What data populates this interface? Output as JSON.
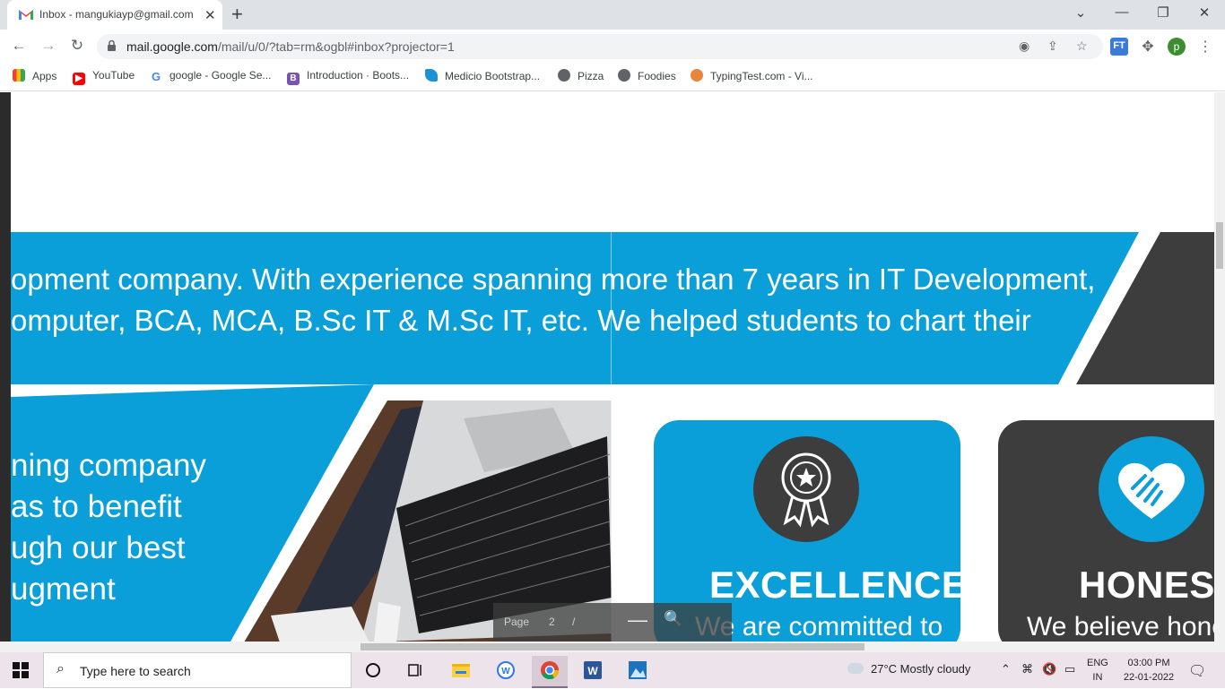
{
  "browser": {
    "tab_title": "Inbox - mangukiayp@gmail.com",
    "tab_close": "✕",
    "new_tab": "+",
    "window": {
      "minimize": "⌄",
      "min": "—",
      "restore": "❐",
      "close": "✕"
    },
    "url_host": "mail.google.com",
    "url_path": "/mail/u/0/?tab=rm&ogbl#inbox?projector=1",
    "profile_initial": "p",
    "ext_label": "FT"
  },
  "bookmarks": [
    {
      "label": "Apps",
      "icon": "apps-grid-icon"
    },
    {
      "label": "YouTube",
      "icon": "youtube-icon"
    },
    {
      "label": "google - Google Se...",
      "icon": "google-icon"
    },
    {
      "label": "Introduction · Boots...",
      "icon": "bootstrap-icon"
    },
    {
      "label": "Medicio Bootstrap...",
      "icon": "medicio-icon"
    },
    {
      "label": "Pizza",
      "icon": "globe-icon"
    },
    {
      "label": "Foodies",
      "icon": "globe-icon"
    },
    {
      "label": "TypingTest.com - Vi...",
      "icon": "typingtest-icon"
    }
  ],
  "slide": {
    "band_line1": "opment company. With experience spanning more than 7 years in IT Development,",
    "band_line2": "omputer, BCA, MCA, B.Sc IT & M.Sc IT, etc. We helped students to chart their",
    "left_lines": [
      "ning company",
      "as to benefit",
      "ugh our best",
      "ugment"
    ],
    "cards": [
      {
        "title": "EXCELLENCE",
        "text": "We are committed to",
        "icon": "award-ribbon-icon"
      },
      {
        "title": "HONESTY",
        "text": "We believe honest",
        "icon": "heart-hand-icon"
      }
    ],
    "colors": {
      "blue": "#0a9fd8",
      "dark": "#3d3d3d"
    }
  },
  "projector": {
    "page_label": "Page",
    "page_num": "2",
    "page_sep": "/",
    "minus": "—",
    "zoom": "🔍"
  },
  "taskbar": {
    "search_placeholder": "Type here to search",
    "weather": "27°C  Mostly cloudy",
    "lang1": "ENG",
    "lang2": "IN",
    "time": "03:00 PM",
    "date": "22-01-2022"
  }
}
